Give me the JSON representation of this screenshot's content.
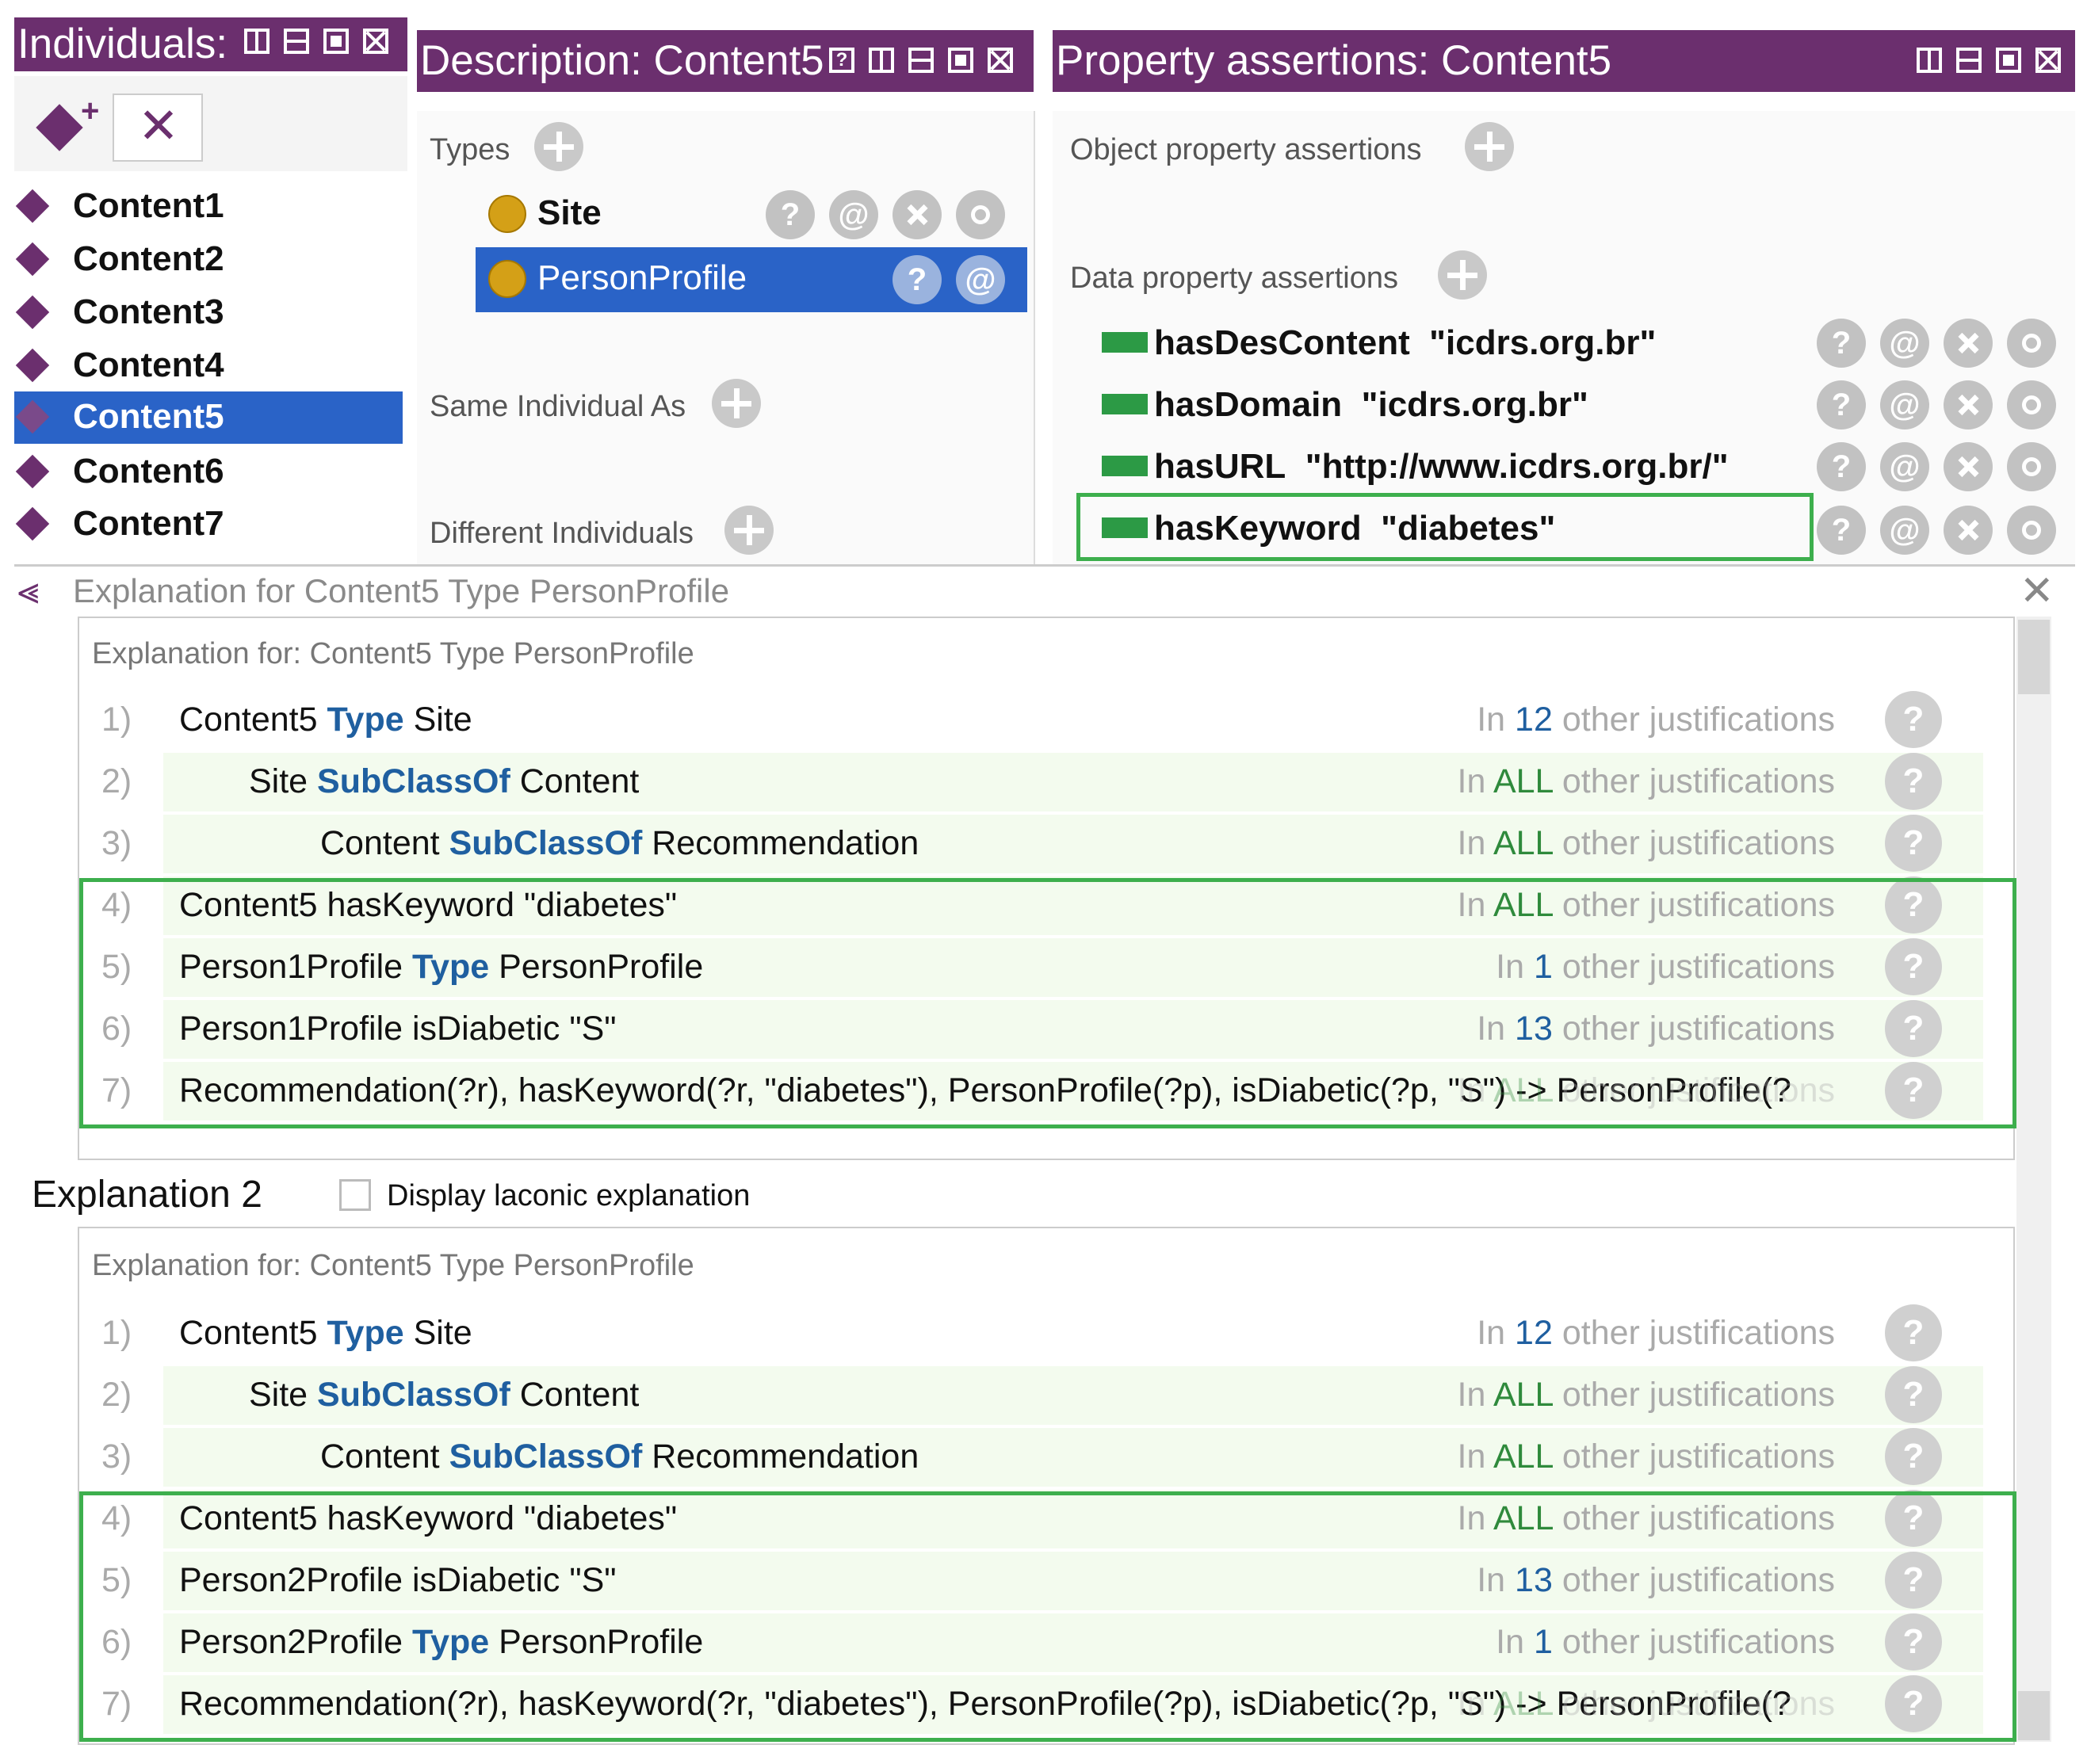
{
  "individuals_panel": {
    "title": "Individuals:",
    "items": [
      "Content1",
      "Content2",
      "Content3",
      "Content4",
      "Content5",
      "Content6",
      "Content7"
    ],
    "selected": "Content5"
  },
  "description_panel": {
    "title": "Description: Content5",
    "types_label": "Types",
    "types": [
      "Site",
      "PersonProfile"
    ],
    "same_individual_label": "Same Individual As",
    "different_individuals_label": "Different Individuals"
  },
  "property_panel": {
    "title": "Property assertions: Content5",
    "object_label": "Object property assertions",
    "data_label": "Data property assertions",
    "assertions": [
      {
        "prop": "hasDesContent",
        "value": "\"icdrs.org.br\""
      },
      {
        "prop": "hasDomain",
        "value": "\"icdrs.org.br\""
      },
      {
        "prop": "hasURL",
        "value": "\"http://www.icdrs.org.br/\""
      },
      {
        "prop": "hasKeyword",
        "value": "\"diabetes\""
      }
    ]
  },
  "explanation_dialog": {
    "title": "Explanation for Content5 Type PersonProfile",
    "explanation1_header": "Explanation for: Content5 Type PersonProfile",
    "explanation2_label": "Explanation 2",
    "laconic_label": "Display laconic explanation",
    "explanation2_header": "Explanation for: Content5 Type PersonProfile",
    "kw_type": "Type",
    "kw_subclass": "SubClassOf",
    "just_in": "In",
    "just_other": "other justifications",
    "rows1": [
      {
        "num": "1)",
        "a": "Content5 ",
        "k": "Type",
        "b": " Site",
        "count": "12"
      },
      {
        "num": "2)",
        "a": "Site ",
        "k": "SubClassOf",
        "b": " Content",
        "count": "ALL"
      },
      {
        "num": "3)",
        "a": "Content ",
        "k": "SubClassOf",
        "b": " Recommendation",
        "count": "ALL"
      },
      {
        "num": "4)",
        "a": "Content5 hasKeyword \"diabetes\"",
        "k": "",
        "b": "",
        "count": "ALL"
      },
      {
        "num": "5)",
        "a": "Person1Profile ",
        "k": "Type",
        "b": " PersonProfile",
        "count": "1"
      },
      {
        "num": "6)",
        "a": "Person1Profile isDiabetic \"S\"",
        "k": "",
        "b": "",
        "count": "13"
      },
      {
        "num": "7)",
        "a": "Recommendation(?r), hasKeyword(?r, \"diabetes\"), PersonProfile(?p), isDiabetic(?p, \"S\") -> PersonProfile(?",
        "k": "",
        "b": "",
        "count": "ALL"
      }
    ],
    "rows2": [
      {
        "num": "1)",
        "a": "Content5 ",
        "k": "Type",
        "b": " Site",
        "count": "12"
      },
      {
        "num": "2)",
        "a": "Site ",
        "k": "SubClassOf",
        "b": " Content",
        "count": "ALL"
      },
      {
        "num": "3)",
        "a": "Content ",
        "k": "SubClassOf",
        "b": " Recommendation",
        "count": "ALL"
      },
      {
        "num": "4)",
        "a": "Content5 hasKeyword \"diabetes\"",
        "k": "",
        "b": "",
        "count": "ALL"
      },
      {
        "num": "5)",
        "a": "Person2Profile isDiabetic \"S\"",
        "k": "",
        "b": "",
        "count": "13"
      },
      {
        "num": "6)",
        "a": "Person2Profile ",
        "k": "Type",
        "b": " PersonProfile",
        "count": "1"
      },
      {
        "num": "7)",
        "a": "Recommendation(?r), hasKeyword(?r, \"diabetes\"), PersonProfile(?p), isDiabetic(?p, \"S\") -> PersonProfile(?",
        "k": "",
        "b": "",
        "count": "ALL"
      }
    ]
  },
  "colors": {
    "header_purple": "#6b2f6e",
    "selection_blue": "#2a63c7",
    "highlight_green": "#3daf4d",
    "keyword_blue": "#1f5fa0",
    "count_green": "#2f8a3c"
  }
}
